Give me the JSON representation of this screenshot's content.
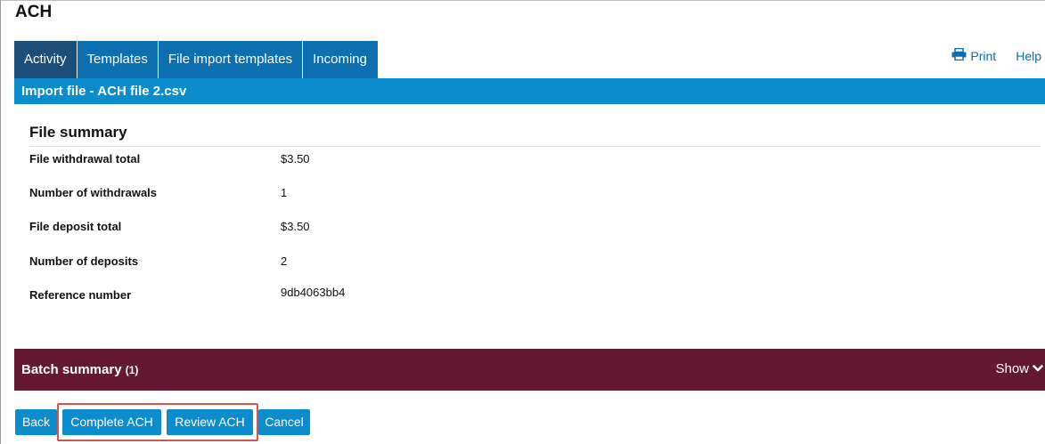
{
  "page": {
    "title": "ACH"
  },
  "tabs": [
    {
      "label": "Activity",
      "active": true
    },
    {
      "label": "Templates",
      "active": false
    },
    {
      "label": "File import templates",
      "active": false
    },
    {
      "label": "Incoming",
      "active": false
    }
  ],
  "top_links": {
    "print": "Print",
    "help": "Help"
  },
  "title_bar": {
    "text": "Import file - ACH file 2.csv"
  },
  "file_summary": {
    "heading": "File summary",
    "rows": [
      {
        "label": "File withdrawal total",
        "value": "$3.50"
      },
      {
        "label": "Number of withdrawals",
        "value": "1"
      },
      {
        "label": "File deposit total",
        "value": "$3.50"
      },
      {
        "label": "Number of deposits",
        "value": "2"
      },
      {
        "label": "Reference number",
        "value": "9db4063bb4"
      }
    ]
  },
  "batch_summary": {
    "title": "Batch summary",
    "count": "(1)",
    "toggle": "Show"
  },
  "buttons": {
    "back": "Back",
    "complete": "Complete ACH",
    "review": "Review ACH",
    "cancel": "Cancel"
  },
  "colors": {
    "primary_blue": "#0a8ccd",
    "tab_blue": "#0b6fb0",
    "tab_active": "#1b4e79",
    "batch_bar": "#641832",
    "highlight": "#d9534f"
  }
}
